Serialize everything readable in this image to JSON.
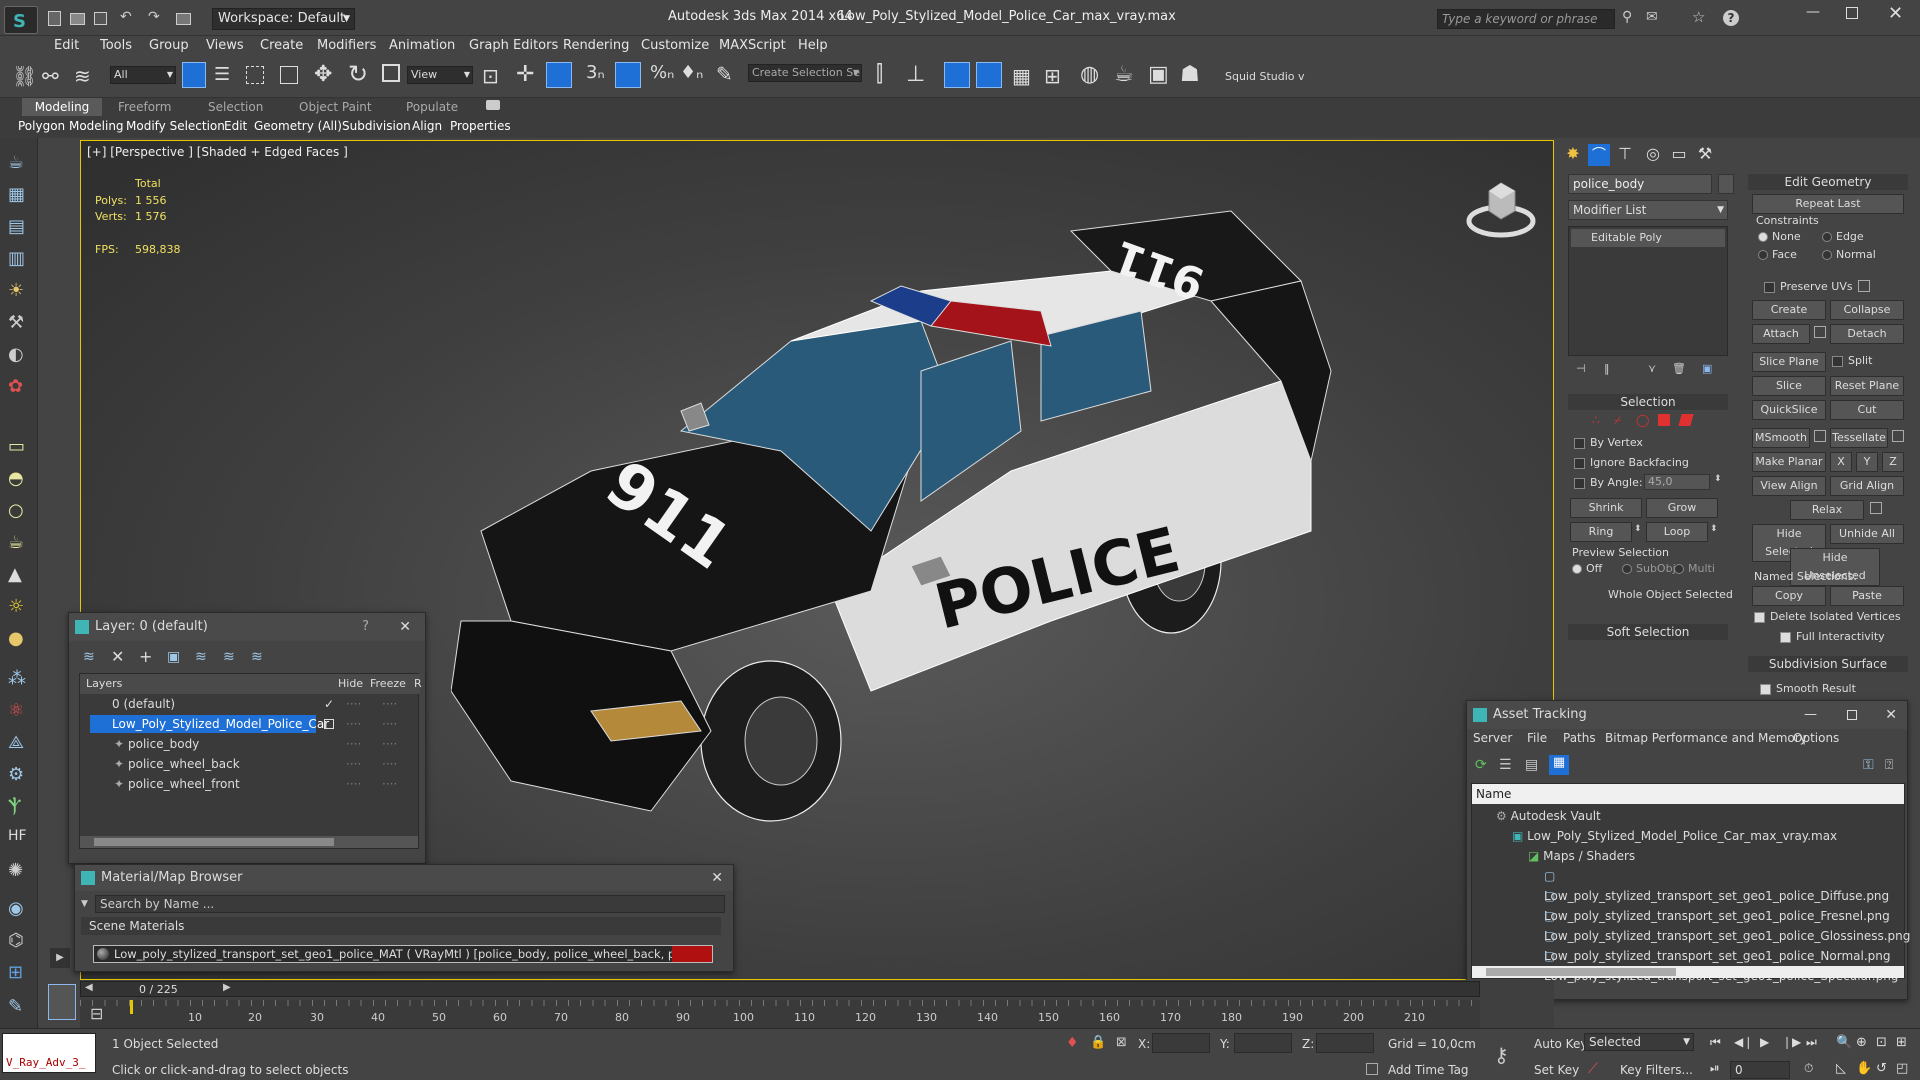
{
  "titlebar": {
    "workspace": "Workspace: Default",
    "app_title": "Autodesk 3ds Max  2014 x64",
    "file_title": "Low_Poly_Stylized_Model_Police_Car_max_vray.max",
    "search_placeholder": "Type a keyword or phrase"
  },
  "menu": [
    "Edit",
    "Tools",
    "Group",
    "Views",
    "Create",
    "Modifiers",
    "Animation",
    "Graph Editors",
    "Rendering",
    "Customize",
    "MAXScript",
    "Help"
  ],
  "toolbar": {
    "filter_value": "All",
    "view_value": "View",
    "selection_set_placeholder": "Create Selection Se",
    "squid_label": "Squid Studio v"
  },
  "ribbon": {
    "tabs": [
      "Modeling",
      "Freeform",
      "Selection",
      "Object Paint",
      "Populate"
    ],
    "subtabs": [
      "Polygon Modeling",
      "Modify Selection",
      "Edit",
      "Geometry (All)",
      "Subdivision",
      "Align",
      "Properties"
    ]
  },
  "viewport": {
    "label": "[+] [Perspective ] [Shaded + Edged Faces ]",
    "stats_total": "Total",
    "polys_label": "Polys:",
    "polys_value": "1 556",
    "verts_label": "Verts:",
    "verts_value": "1 576",
    "fps_label": "FPS:",
    "fps_value": "598,838",
    "decal_911": "911",
    "decal_police": "POLICE",
    "decal_roof": "911"
  },
  "layer_window": {
    "title": "Layer: 0 (default)",
    "cols": [
      "Layers",
      "Hide",
      "Freeze",
      "R"
    ],
    "rows": [
      {
        "name": "0 (default)",
        "indent": 1,
        "selected": false
      },
      {
        "name": "Low_Poly_Stylized_Model_Police_Car",
        "indent": 1,
        "selected": true
      },
      {
        "name": "police_body",
        "indent": 2,
        "selected": false
      },
      {
        "name": "police_wheel_back",
        "indent": 2,
        "selected": false
      },
      {
        "name": "police_wheel_front",
        "indent": 2,
        "selected": false
      }
    ]
  },
  "material_browser": {
    "title": "Material/Map Browser",
    "search_placeholder": "Search by Name ...",
    "section": "Scene Materials",
    "material": "Low_poly_stylized_transport_set_geo1_police_MAT ( VRayMtl ) [police_body, police_wheel_back, police_wheel_front]"
  },
  "command_panel": {
    "object_name": "police_body",
    "modifier_list": "Modifier List",
    "stack_item": "Editable Poly",
    "selection_title": "Selection",
    "by_vertex": "By Vertex",
    "ignore_backfacing": "Ignore Backfacing",
    "by_angle": "By Angle:",
    "by_angle_value": "45,0",
    "shrink": "Shrink",
    "grow": "Grow",
    "ring": "Ring",
    "loop": "Loop",
    "preview_selection": "Preview Selection",
    "off": "Off",
    "subobj": "SubObj",
    "multi": "Multi",
    "whole_object": "Whole Object Selected",
    "soft_selection": "Soft Selection",
    "edit_geometry": "Edit Geometry",
    "repeat_last": "Repeat Last",
    "constraints": "Constraints",
    "none": "None",
    "edge": "Edge",
    "face": "Face",
    "normal": "Normal",
    "preserve_uvs": "Preserve UVs",
    "create": "Create",
    "collapse": "Collapse",
    "attach": "Attach",
    "detach": "Detach",
    "slice_plane": "Slice Plane",
    "split": "Split",
    "slice": "Slice",
    "reset_plane": "Reset Plane",
    "quickslice": "QuickSlice",
    "cut": "Cut",
    "msmooth": "MSmooth",
    "tessellate": "Tessellate",
    "make_planar": "Make Planar",
    "x": "X",
    "y": "Y",
    "z": "Z",
    "view_align": "View Align",
    "grid_align": "Grid Align",
    "relax": "Relax",
    "hide_selected": "Hide Selected",
    "unhide_all": "Unhide All",
    "hide_unselected": "Hide Unselected",
    "named_selections": "Named Selections:",
    "copy": "Copy",
    "paste": "Paste",
    "delete_isolated": "Delete Isolated Vertices",
    "full_interactivity": "Full Interactivity",
    "subdivision_surface": "Subdivision Surface",
    "smooth_result": "Smooth Result"
  },
  "asset_tracking": {
    "title": "Asset Tracking",
    "menu": [
      "Server",
      "File",
      "Paths",
      "Bitmap Performance and Memory",
      "Options"
    ],
    "col_name": "Name",
    "items": [
      {
        "label": "Autodesk Vault",
        "indent": 0
      },
      {
        "label": "Low_Poly_Stylized_Model_Police_Car_max_vray.max",
        "indent": 1
      },
      {
        "label": "Maps / Shaders",
        "indent": 2
      },
      {
        "label": "Low_poly_stylized_transport_set_geo1_police_Diffuse.png",
        "indent": 3
      },
      {
        "label": "Low_poly_stylized_transport_set_geo1_police_Fresnel.png",
        "indent": 3
      },
      {
        "label": "Low_poly_stylized_transport_set_geo1_police_Glossiness.png",
        "indent": 3
      },
      {
        "label": "Low_poly_stylized_transport_set_geo1_police_Normal.png",
        "indent": 3
      },
      {
        "label": "Low_poly_stylized_transport_set_geo1_police_Specular.png",
        "indent": 3
      }
    ]
  },
  "timeline": {
    "frame": "0 / 225",
    "ticks": [
      "10",
      "20",
      "30",
      "40",
      "50",
      "60",
      "70",
      "80",
      "90",
      "100",
      "110",
      "120",
      "130",
      "140",
      "150",
      "160",
      "170",
      "180",
      "190",
      "200",
      "210"
    ]
  },
  "status": {
    "script_label": "V_Ray_Adv_3_",
    "selected": "1 Object Selected",
    "hint": "Click or click-and-drag to select objects",
    "x_label": "X:",
    "y_label": "Y:",
    "z_label": "Z:",
    "grid": "Grid = 10,0cm",
    "add_time_tag": "Add Time Tag",
    "auto_key": "Auto Key",
    "set_key": "Set Key",
    "key_mode": "Selected",
    "key_filters": "Key Filters...",
    "frame_value": "0"
  },
  "colors": {
    "accent": "#1e6fd6",
    "selection": "#1e6fd6",
    "viewport_border": "#e6c800"
  }
}
